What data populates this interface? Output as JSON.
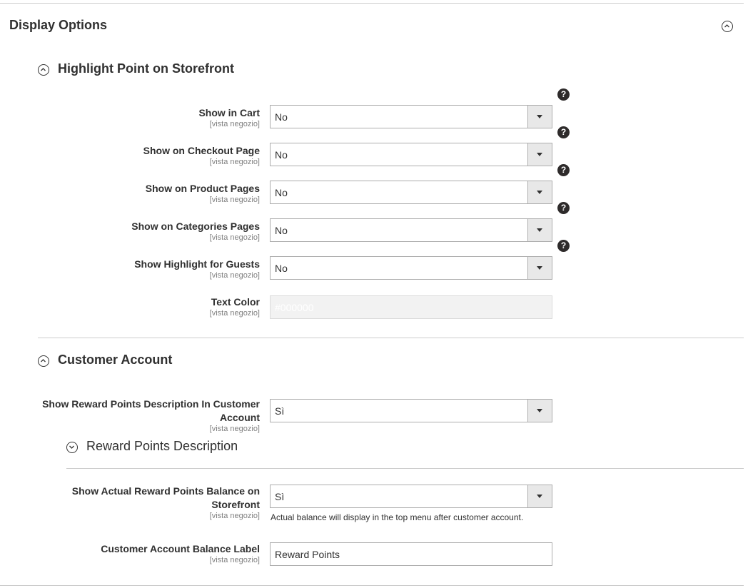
{
  "section": {
    "title": "Display Options"
  },
  "highlight": {
    "title": "Highlight Point on Storefront",
    "rows": [
      {
        "label": "Show in Cart",
        "scope": "[vista negozio]",
        "value": "No"
      },
      {
        "label": "Show on Checkout Page",
        "scope": "[vista negozio]",
        "value": "No"
      },
      {
        "label": "Show on Product Pages",
        "scope": "[vista negozio]",
        "value": "No"
      },
      {
        "label": "Show on Categories Pages",
        "scope": "[vista negozio]",
        "value": "No"
      },
      {
        "label": "Show Highlight for Guests",
        "scope": "[vista negozio]",
        "value": "No"
      }
    ],
    "text_color": {
      "label": "Text Color",
      "scope": "[vista negozio]",
      "value": "#000000"
    }
  },
  "customer_account": {
    "title": "Customer Account",
    "show_description": {
      "label": "Show Reward Points Description In Customer Account",
      "scope": "[vista negozio]",
      "value": "Sì"
    },
    "description_group": {
      "title": "Reward Points Description"
    },
    "show_balance": {
      "label": "Show Actual Reward Points Balance on Storefront",
      "scope": "[vista negozio]",
      "value": "Sì",
      "note": "Actual balance will display in the top menu after customer account."
    },
    "balance_label": {
      "label": "Customer Account Balance Label",
      "scope": "[vista negozio]",
      "value": "Reward Points"
    }
  },
  "help_symbol": "?"
}
